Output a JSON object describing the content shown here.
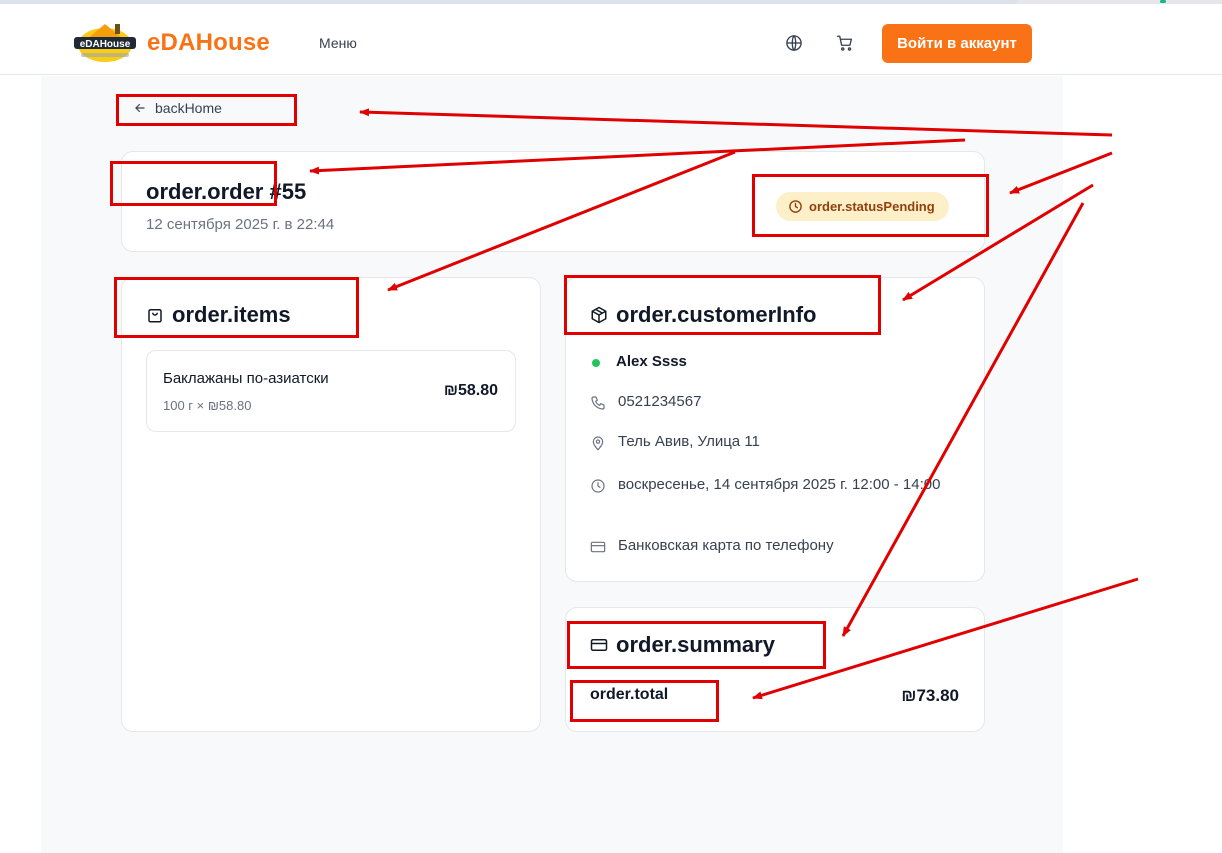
{
  "header": {
    "brand": "eDAHouse",
    "logo_text": "eDAHouse",
    "nav_menu": "Меню",
    "login_button": "Войти в аккаунт"
  },
  "back_link": "backHome",
  "order": {
    "title": "order.order #55",
    "date": "12 сентября 2025 г. в 22:44",
    "status": "order.statusPending"
  },
  "items_section": {
    "heading": "order.items",
    "items": [
      {
        "name": "Баклажаны по-азиатски",
        "qty": "100 г × ₪58.80",
        "price": "₪58.80"
      }
    ]
  },
  "customer_section": {
    "heading": "order.customerInfo",
    "name": "Alex Ssss",
    "phone": "0521234567",
    "address": "Тель Авив, Улица 11",
    "delivery_time": "воскресенье, 14 сентября 2025 г. 12:00 - 14:00",
    "payment": "Банковская карта по телефону"
  },
  "summary_section": {
    "heading": "order.summary",
    "total_label": "order.total",
    "total_value": "₪73.80"
  },
  "colors": {
    "accent": "#f97316",
    "status_bg": "#fdf0c8",
    "status_text": "#92400e",
    "annotation": "#e00000",
    "online_dot": "#22c55e"
  }
}
